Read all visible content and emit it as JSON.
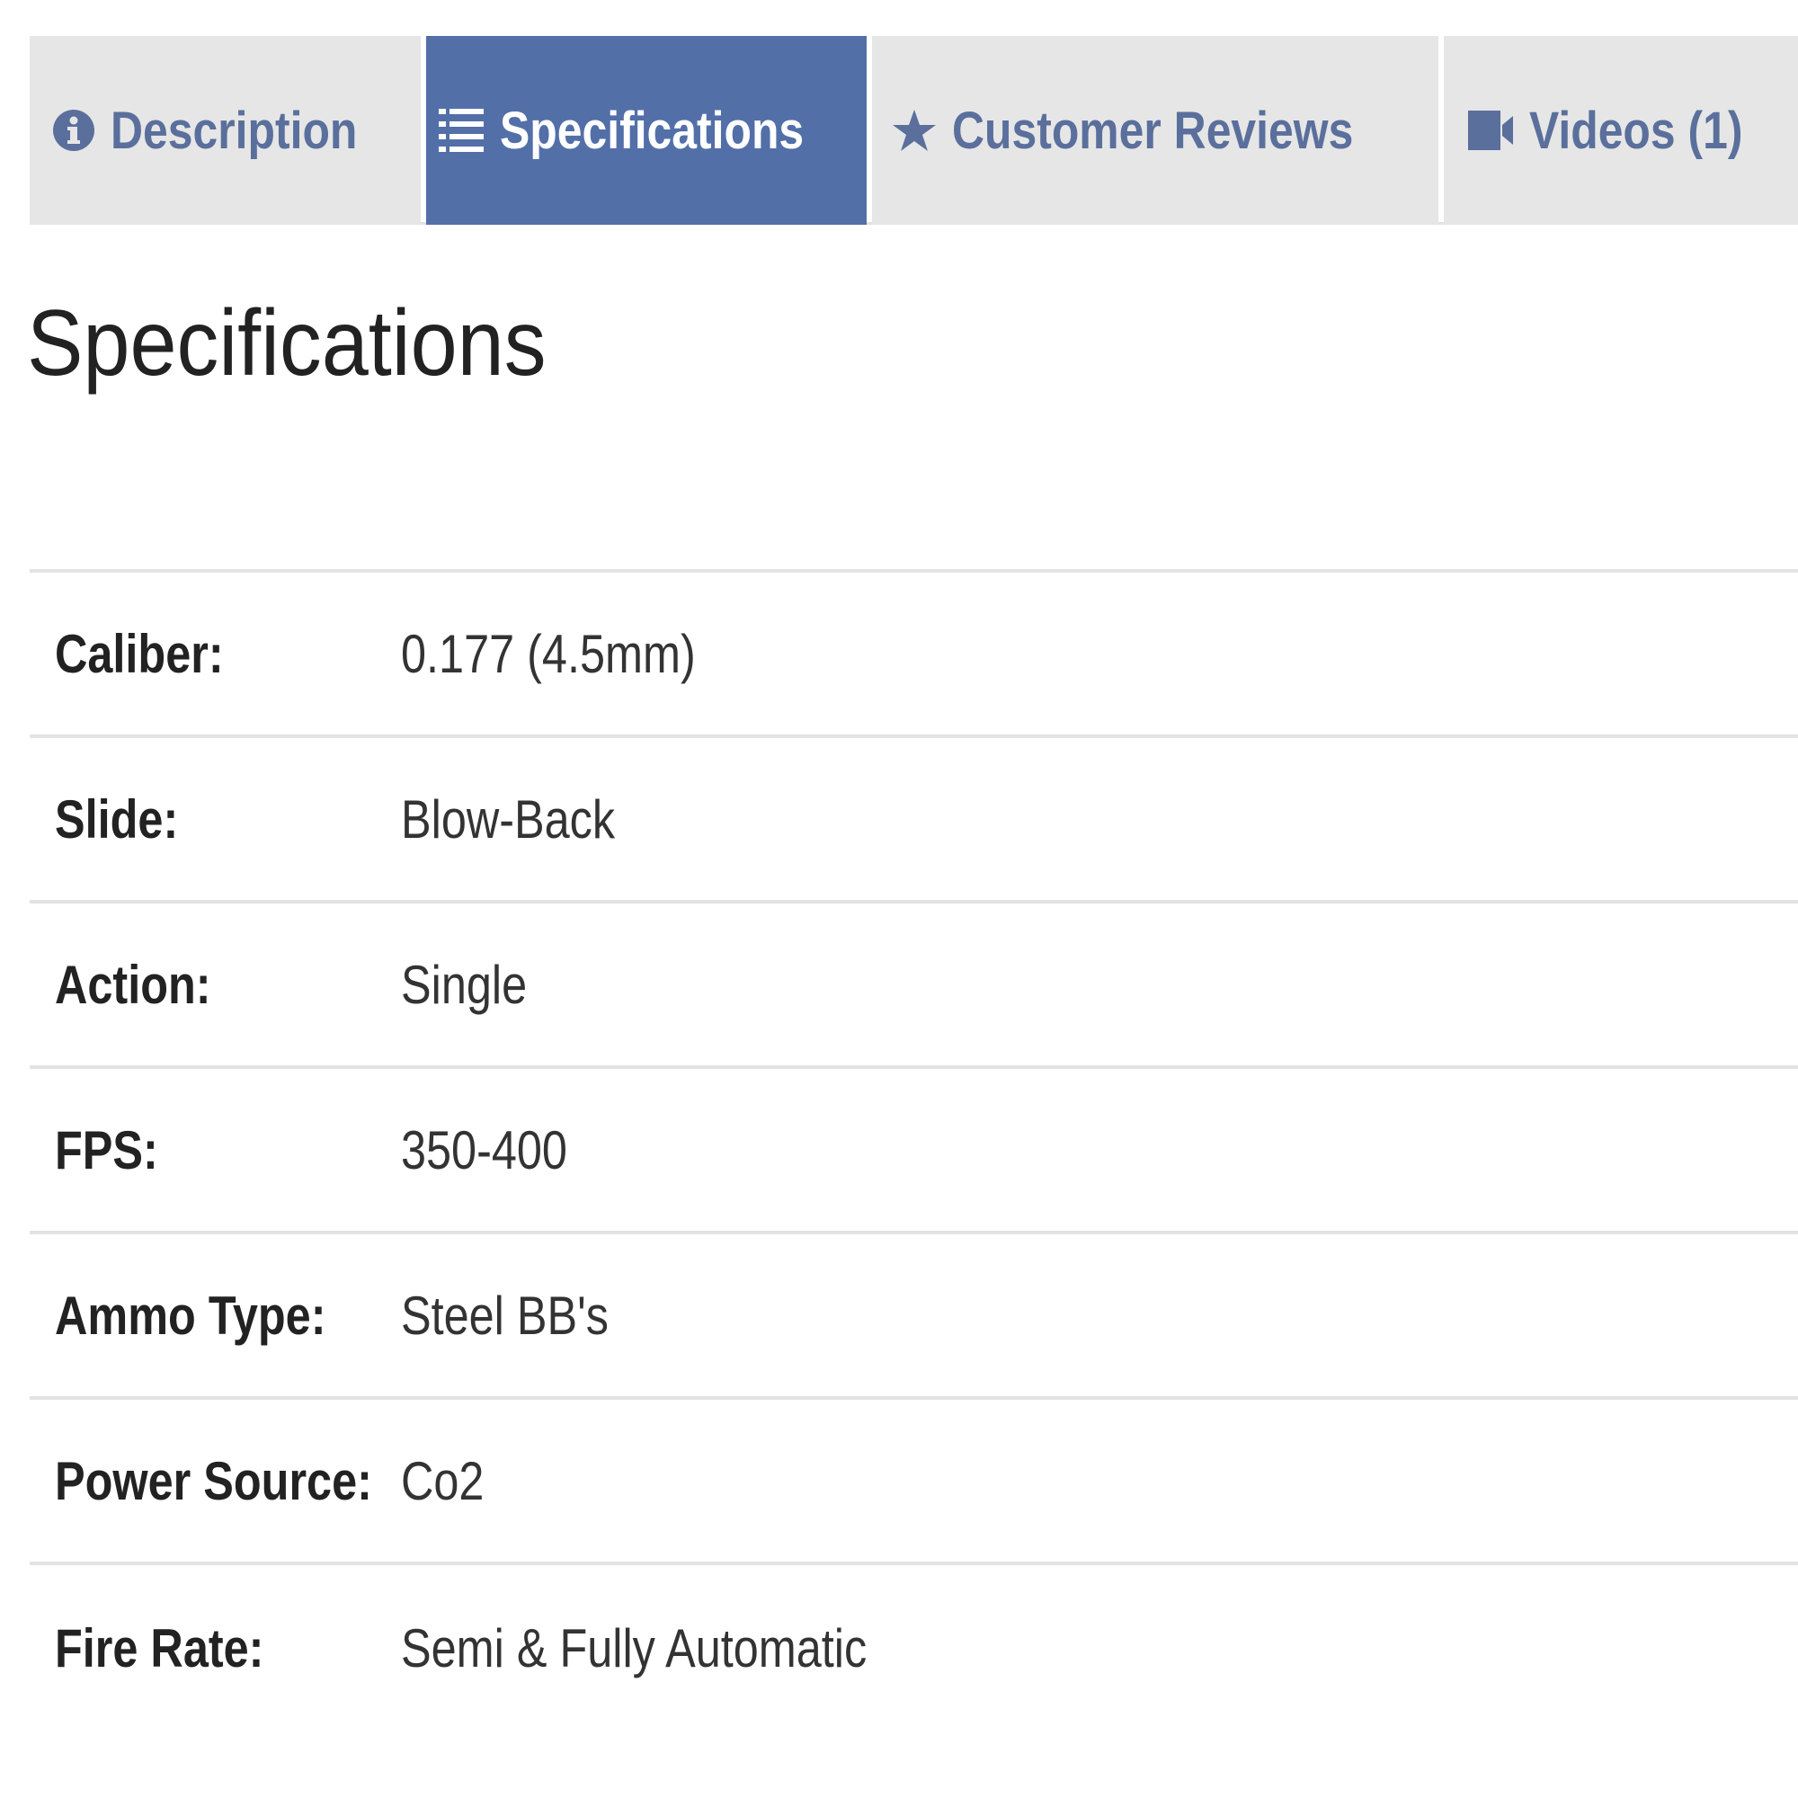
{
  "tabs": [
    {
      "label": "Description",
      "icon": "info-circle-icon",
      "active": false
    },
    {
      "label": "Specifications",
      "icon": "list-icon",
      "active": true
    },
    {
      "label": "Customer Reviews",
      "icon": "star-icon",
      "active": false
    },
    {
      "label": "Videos (1)",
      "icon": "video-camera-icon",
      "active": false
    }
  ],
  "colors": {
    "active_tab": "#526fa8",
    "inactive_tab": "#e6e6e6",
    "tab_text": "#5a6f9c"
  },
  "heading": "Specifications",
  "specs": [
    {
      "label": "Caliber:",
      "value": "0.177 (4.5mm)"
    },
    {
      "label": "Slide:",
      "value": "Blow-Back"
    },
    {
      "label": "Action:",
      "value": "Single"
    },
    {
      "label": "FPS:",
      "value": "350-400"
    },
    {
      "label": "Ammo Type:",
      "value": "Steel BB's"
    },
    {
      "label": "Power Source:",
      "value": "Co2"
    },
    {
      "label": "Fire Rate:",
      "value": "Semi & Fully Automatic"
    }
  ]
}
